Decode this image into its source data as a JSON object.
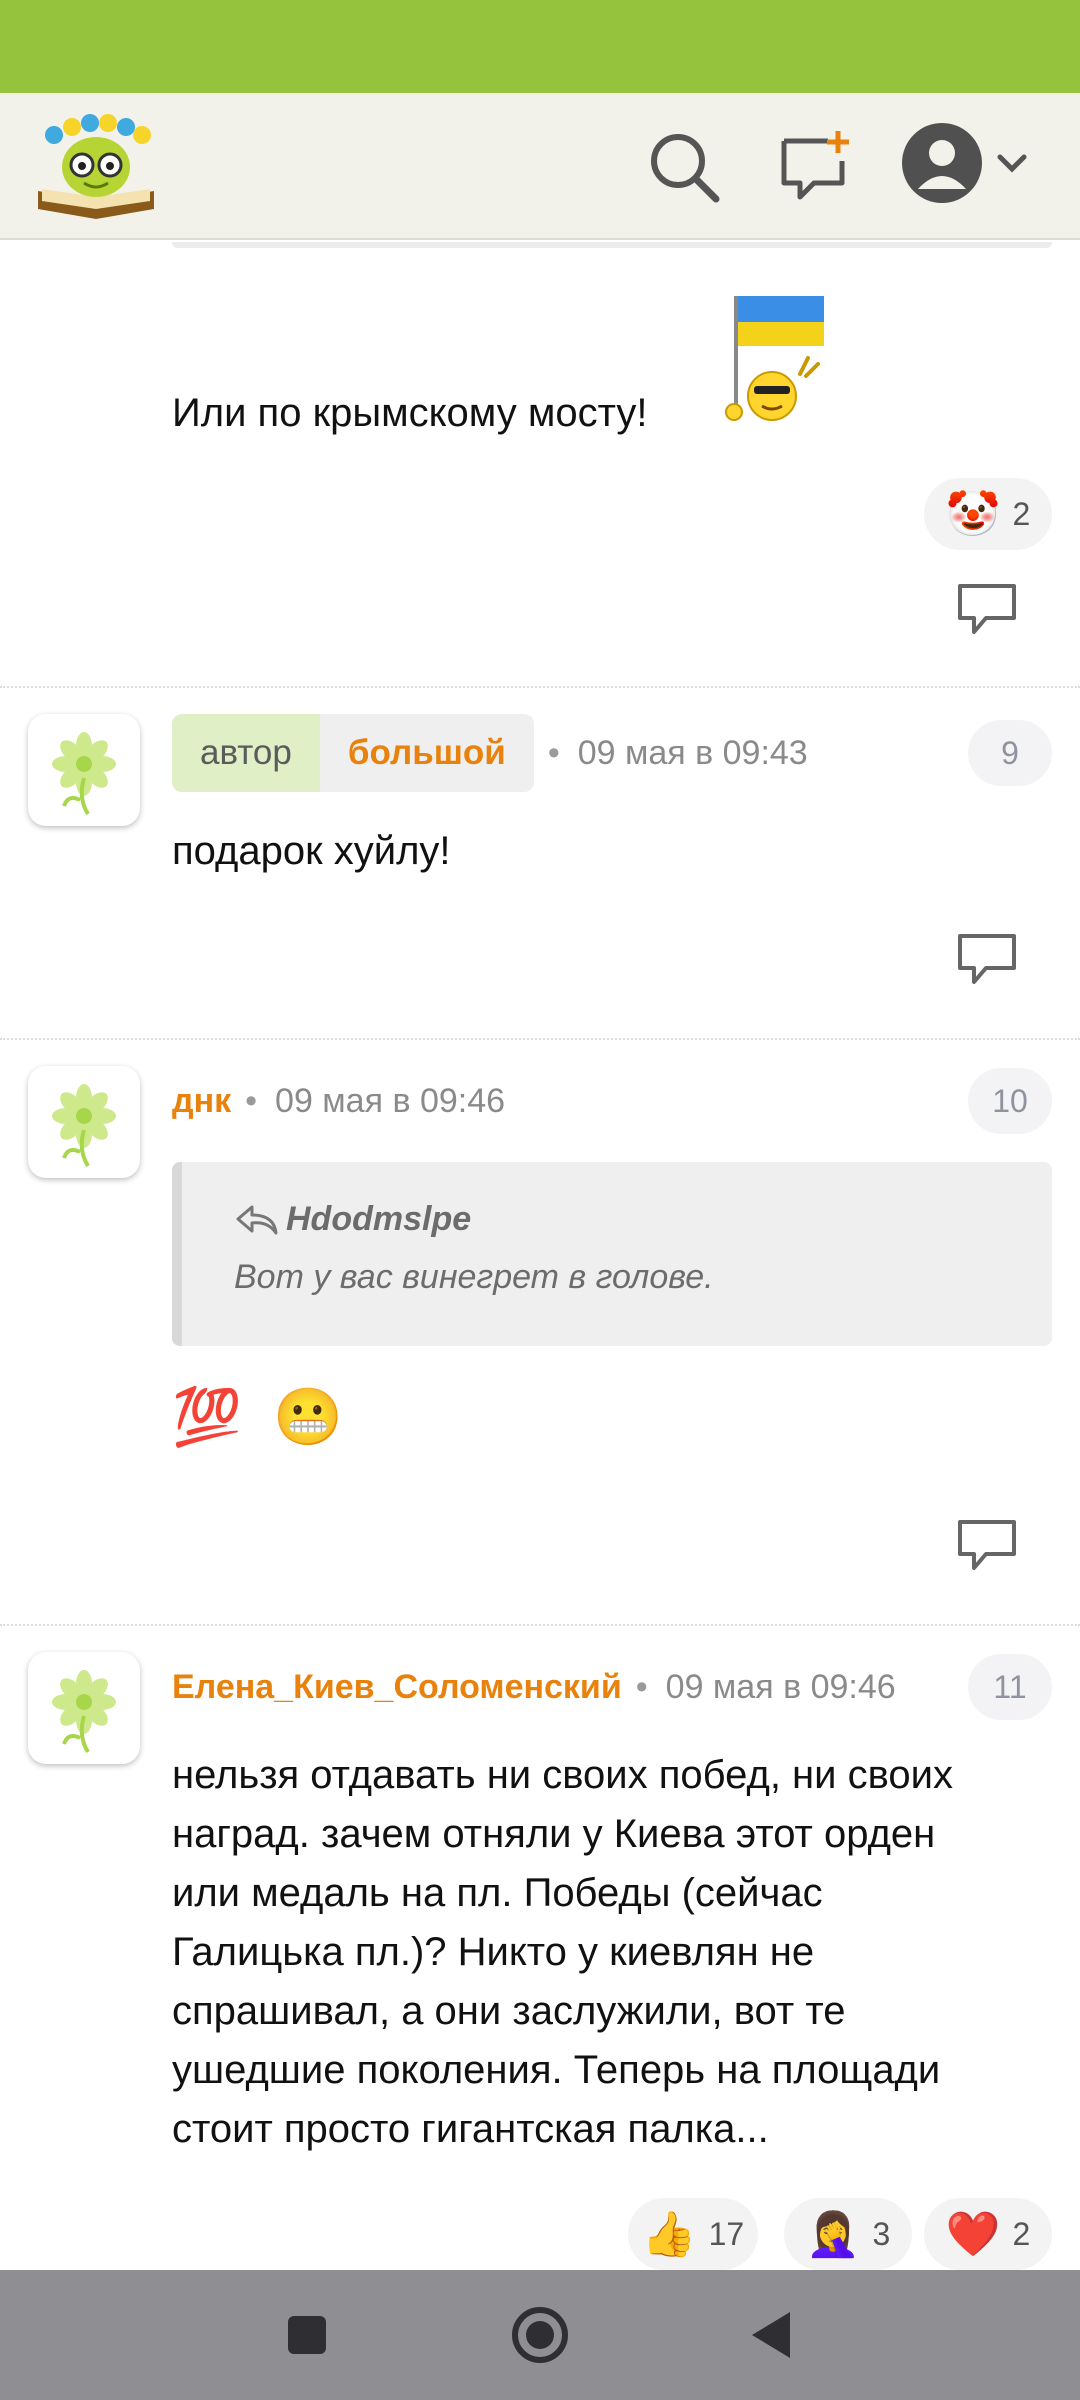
{
  "comments": [
    {
      "text": "Или по крымскому мосту!",
      "reactions": [
        {
          "icon": "clown-face",
          "emoji": "🤡",
          "count": "2"
        }
      ]
    },
    {
      "author_tag": "автор",
      "author": "большой",
      "time": "09 мая в 09:43",
      "number": "9",
      "text": "подарок хуйлу!"
    },
    {
      "author": "днк",
      "time": "09 мая в 09:46",
      "number": "10",
      "quote_author": "Hdodmslpe",
      "quote_text": "Вот у вас винегрет в голове.",
      "emojis": "💯 😬"
    },
    {
      "author": "Елена_Киев_Соломенский",
      "time": "09 мая в 09:46",
      "number": "11",
      "text_lines": [
        "нельзя отдавать ни своих побед, ни своих",
        "наград. зачем отняли у Киева этот орден",
        "или медаль на пл. Победы (сейчас",
        "Галицька пл.)? Никто у киевлян не",
        "спрашивал, а они заслужили, вот те",
        "ушедшие поколения. Теперь на площади",
        "стоит просто гигантская палка..."
      ],
      "reactions": [
        {
          "icon": "thumbs-up",
          "emoji": "👍",
          "count": "17"
        },
        {
          "icon": "facepalm",
          "emoji": "🤦‍♀️",
          "count": "3"
        },
        {
          "icon": "red-heart",
          "emoji": "❤️",
          "count": "2"
        }
      ]
    }
  ],
  "colors": {
    "status_bar": "#95c33e",
    "app_bar": "#f2f2ea",
    "accent_orange": "#e8820c",
    "author_tag_bg": "#e0efc6",
    "nav_bar": "#8e8e93"
  }
}
